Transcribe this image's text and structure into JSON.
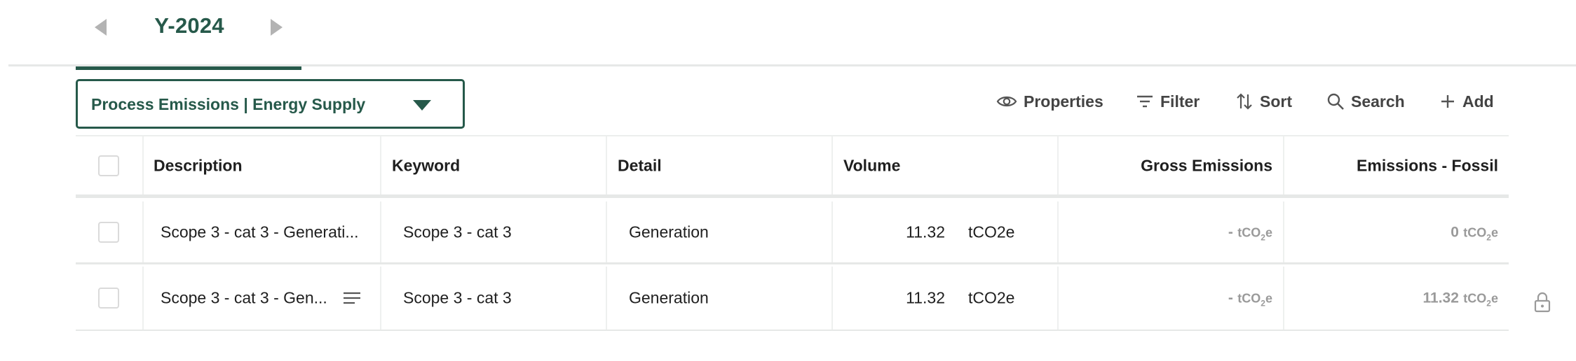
{
  "period": {
    "year": "Y-2024",
    "prev_label": "",
    "next_label": ""
  },
  "dropdown": {
    "selected": "Process Emissions | Energy Supply"
  },
  "toolbar": {
    "properties": "Properties",
    "filter": "Filter",
    "sort": "Sort",
    "search": "Search",
    "add": "Add"
  },
  "table": {
    "columns": [
      "Description",
      "Keyword",
      "Detail",
      "Volume",
      "Gross Emissions",
      "Emissions - Fossil"
    ],
    "rows": [
      {
        "description": "Scope 3 - cat 3 - Generati...",
        "keyword": "Scope 3 - cat 3",
        "detail": "Generation",
        "volume": "11.32",
        "volume_unit": "tCO2e",
        "gross": "-",
        "gross_unit": "tCO",
        "gross_unit_sub": "2",
        "gross_unit_tail": "e",
        "fossil": "0",
        "fossil_unit": "tCO",
        "fossil_unit_sub": "2",
        "fossil_unit_tail": "e",
        "has_notes_icon": false,
        "locked": false
      },
      {
        "description": "Scope 3 - cat 3 - Gen...",
        "keyword": "Scope 3 - cat 3",
        "detail": "Generation",
        "volume": "11.32",
        "volume_unit": "tCO2e",
        "gross": "-",
        "gross_unit": "tCO",
        "gross_unit_sub": "2",
        "gross_unit_tail": "e",
        "fossil": "11.32",
        "fossil_unit": "tCO",
        "fossil_unit_sub": "2",
        "fossil_unit_tail": "e",
        "has_notes_icon": true,
        "locked": true
      }
    ]
  },
  "icons": {
    "prev": "chevron-left-icon",
    "next": "chevron-right-icon",
    "dropdown": "caret-down-icon",
    "properties": "eye-icon",
    "filter": "filter-icon",
    "sort": "sort-icon",
    "search": "search-icon",
    "add": "plus-icon",
    "notes": "notes-icon",
    "lock": "lock-icon"
  },
  "colors": {
    "brand": "#26594a",
    "text": "#1f1f1f",
    "muted": "#9a9a9a",
    "toolbar": "#444444"
  }
}
